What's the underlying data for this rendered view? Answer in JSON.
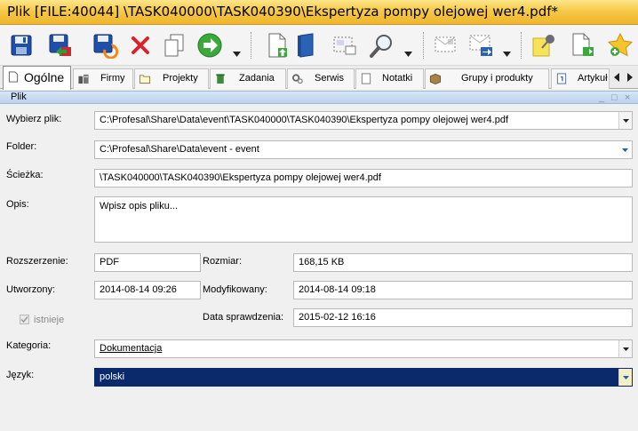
{
  "window": {
    "title": "Plik [FILE:40044]  \\TASK040000\\TASK040390\\Ekspertyza pompy olejowej wer4.pdf*"
  },
  "toolbar": {
    "icons": [
      "save-icon",
      "save-and-close-icon",
      "save-and-new-icon",
      "delete-icon",
      "copy-icon",
      "go-next-icon",
      "document-upload-icon",
      "book-icon",
      "select-frame-icon",
      "search-zoom-icon",
      "document-envelope-icon",
      "send-envelope-icon",
      "sticky-note-pin-icon",
      "document-export-icon",
      "star-add-icon"
    ]
  },
  "tabs": [
    {
      "label": "Ogólne",
      "icon": "document-icon",
      "active": true
    },
    {
      "label": "Firmy",
      "icon": "buildings-icon"
    },
    {
      "label": "Projekty",
      "icon": "folder-icon"
    },
    {
      "label": "Zadania",
      "icon": "trash-tasks-icon"
    },
    {
      "label": "Serwis",
      "icon": "gears-icon"
    },
    {
      "label": "Notatki",
      "icon": "note-icon"
    },
    {
      "label": "Grupy i produkty",
      "icon": "box-icon"
    },
    {
      "label": "Artykuł",
      "icon": "article-icon"
    }
  ],
  "panel": {
    "title": "Plik",
    "minimize": "_",
    "maximize": "□",
    "close": "×"
  },
  "form": {
    "choose_file": {
      "label": "Wybierz plik:",
      "value": "C:\\Profesal\\Share\\Data\\event\\TASK040000\\TASK040390\\Ekspertyza pompy olejowej wer4.pdf"
    },
    "folder": {
      "label": "Folder:",
      "value": "C:\\Profesal\\Share\\Data\\event - event"
    },
    "path": {
      "label": "Ścieżka:",
      "value": "\\TASK040000\\TASK040390\\Ekspertyza pompy olejowej wer4.pdf"
    },
    "description": {
      "label": "Opis:",
      "placeholder": "Wpisz opis pliku..."
    },
    "extension": {
      "label": "Rozszerzenie:",
      "value": "PDF"
    },
    "size": {
      "label": "Rozmiar:",
      "value": "168,15 KB"
    },
    "created": {
      "label": "Utworzony:",
      "value": "2014-08-14 09:26"
    },
    "modified": {
      "label": "Modyfikowany:",
      "value": "2014-08-14 09:18"
    },
    "exists": {
      "label": "istnieje",
      "checked": true
    },
    "checked_date": {
      "label": "Data sprawdzenia:",
      "value": "2015-02-12 16:16"
    },
    "category": {
      "label": "Kategoria:",
      "value": "Dokumentacja"
    },
    "language": {
      "label": "Język:",
      "value": "polski"
    }
  },
  "colors": {
    "title_bar": "#f7c948",
    "panel_header": "#bcd2ee",
    "selected_field": "#0a2a6b",
    "combo_arrow_blue": "#2a5db0"
  }
}
